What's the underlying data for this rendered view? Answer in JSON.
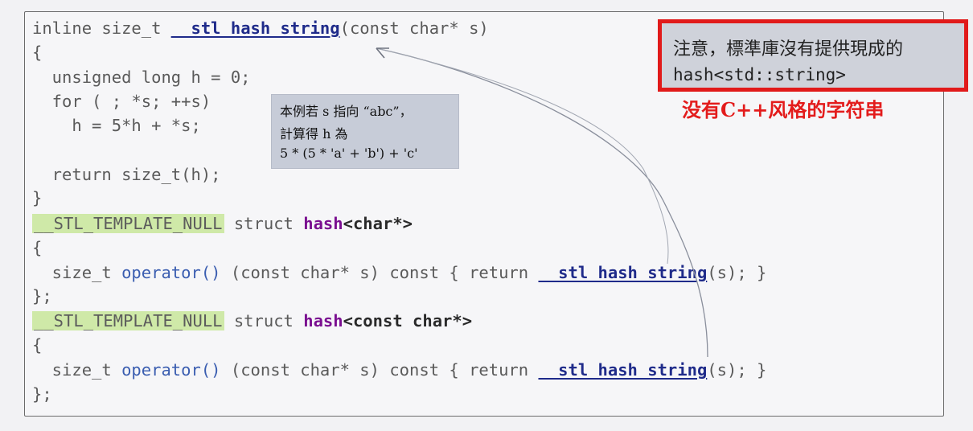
{
  "code_lines": [
    {
      "id": "l1",
      "parts": [
        "inline size_t ",
        "__stl_hash_string",
        "(const char* s)"
      ]
    },
    {
      "id": "l2",
      "text": "{"
    },
    {
      "id": "l3",
      "text": "  unsigned long h = 0;"
    },
    {
      "id": "l4",
      "text": "  for ( ; *s; ++s)"
    },
    {
      "id": "l5",
      "text": "    h = 5*h + *s;"
    },
    {
      "id": "l6",
      "text": "  return size_t(h);"
    },
    {
      "id": "l7",
      "text": "}"
    },
    {
      "id": "l8",
      "parts": [
        "__STL_TEMPLATE_NULL",
        " struct ",
        "hash",
        "<char*>"
      ]
    },
    {
      "id": "l9",
      "text": "{"
    },
    {
      "id": "l10",
      "parts": [
        "  size_t ",
        "operator()",
        " (const char* s) const { return ",
        "__stl_hash_string",
        "(s); }"
      ]
    },
    {
      "id": "l11",
      "text": "};"
    },
    {
      "id": "l12",
      "parts": [
        "__STL_TEMPLATE_NULL",
        " struct ",
        "hash",
        "<const char*>"
      ]
    },
    {
      "id": "l13",
      "text": "{"
    },
    {
      "id": "l14",
      "parts": [
        "  size_t ",
        "operator()",
        " (const char* s) const { return ",
        "__stl_hash_string",
        "(s); }"
      ]
    },
    {
      "id": "l15",
      "text": "};"
    }
  ],
  "tooltip": {
    "line1": "本例若 s 指向 “abc”，",
    "line2": "計算得 h 為",
    "line3": "5 * (5 * 'a' + 'b') + 'c'"
  },
  "note": {
    "line1": "注意，標準庫沒有提供現成的",
    "line2": "hash<std::string>"
  },
  "annotation": "没有C++风格的字符串",
  "colors": {
    "note_border": "#e11a1a",
    "annotation": "#e31c1c",
    "macro_highlight": "#cfe9a8",
    "function_name": "#1f2b8a",
    "keyword_hash": "#7a0e90"
  }
}
